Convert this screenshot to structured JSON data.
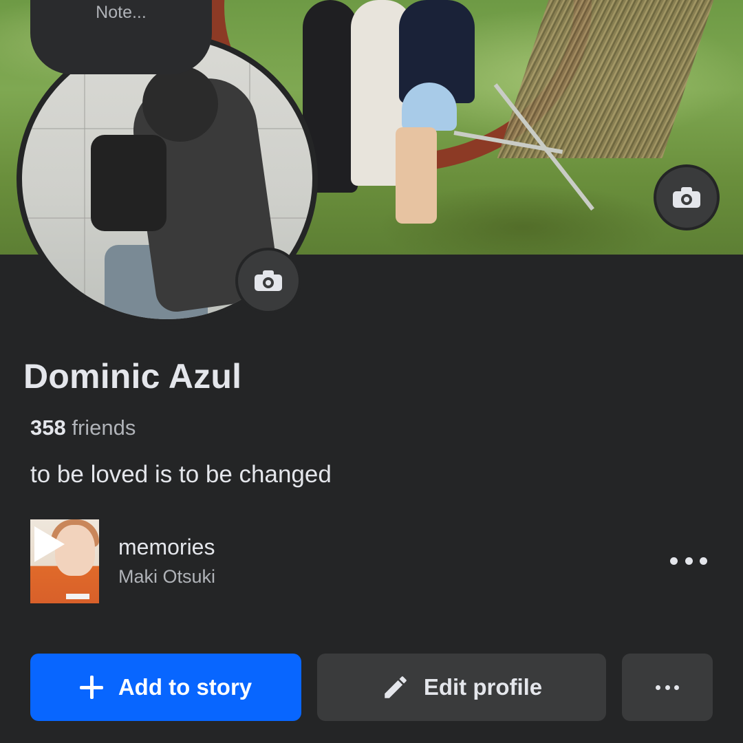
{
  "note": {
    "placeholder": "Note..."
  },
  "cover": {
    "camera_icon": "camera-icon"
  },
  "profile_photo": {
    "camera_icon": "camera-icon"
  },
  "profile": {
    "name": "Dominic Azul",
    "friends_count": "358",
    "friends_label": " friends",
    "bio": "to be loved is to be changed"
  },
  "music": {
    "title": "memories",
    "artist": "Maki Otsuki",
    "play_icon": "play-icon",
    "more_icon": "more-horizontal-icon"
  },
  "actions": {
    "add_to_story": "Add to story",
    "edit_profile": "Edit profile",
    "add_icon": "plus-icon",
    "edit_icon": "pencil-icon",
    "more_icon": "more-horizontal-icon"
  },
  "colors": {
    "background": "#242526",
    "primary_button": "#0866ff",
    "secondary_button": "#3a3b3c",
    "text_primary": "#e4e6eb",
    "text_secondary": "#b0b3b8"
  }
}
